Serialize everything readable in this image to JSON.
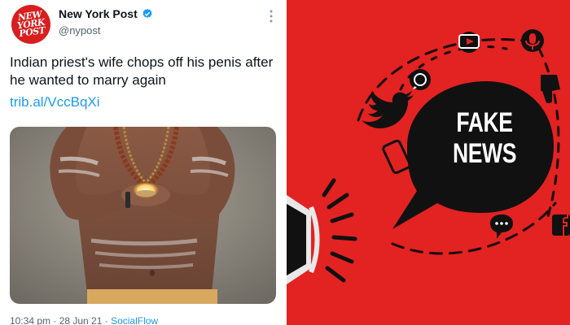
{
  "tweet": {
    "logo_text": "NEW YORK POST",
    "display_name": "New York Post",
    "handle": "@nypost",
    "text": "Indian priest's wife chops off his penis after he wanted to marry again",
    "link": "trib.al/VccBqXi",
    "timestamp": "10:34 pm · 28 Jun 21 · ",
    "source": "SocialFlow",
    "icons": {
      "verified": "verified-badge-icon",
      "more": "more-options-icon"
    },
    "colors": {
      "brand": "#d81e1e",
      "link": "#1d9bf0",
      "verified": "#1d9bf0"
    }
  },
  "graphic": {
    "headline": "FAKE NEWS",
    "background": "#e32222",
    "icons": [
      "youtube-icon",
      "microphone-icon",
      "whatsapp-icon",
      "thumbs-down-icon",
      "twitter-icon",
      "smartphone-icon",
      "chat-bubble-icon",
      "facebook-icon",
      "megaphone-icon"
    ]
  }
}
